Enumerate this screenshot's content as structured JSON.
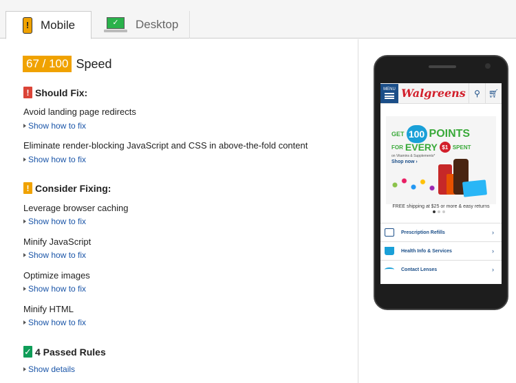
{
  "tabs": {
    "mobile_label": "Mobile",
    "desktop_label": "Desktop"
  },
  "score": {
    "value": "67 / 100",
    "label": "Speed",
    "color": "#f0a200"
  },
  "sections": {
    "should_fix": {
      "title": "Should Fix:",
      "badge": "!",
      "color": "#db4437",
      "rules": [
        {
          "title": "Avoid landing page redirects",
          "link": "Show how to fix"
        },
        {
          "title": "Eliminate render-blocking JavaScript and CSS in above-the-fold content",
          "link": "Show how to fix"
        }
      ]
    },
    "consider_fixing": {
      "title": "Consider Fixing:",
      "badge": "!",
      "color": "#f0a200",
      "rules": [
        {
          "title": "Leverage browser caching",
          "link": "Show how to fix"
        },
        {
          "title": "Minify JavaScript",
          "link": "Show how to fix"
        },
        {
          "title": "Optimize images",
          "link": "Show how to fix"
        },
        {
          "title": "Minify HTML",
          "link": "Show how to fix"
        }
      ]
    },
    "passed": {
      "title": "4 Passed Rules",
      "badge": "✓",
      "color": "#0f9d58",
      "link": "Show details"
    }
  },
  "preview": {
    "menu_label": "MENU",
    "logo": "Walgreens",
    "promo": {
      "get": "GET",
      "hundred": "100",
      "points": "POINTS",
      "for": "FOR",
      "every": "EVERY",
      "dollar": "$1",
      "spent": "SPENT",
      "sub": "on Vitamins & Supplements*",
      "shop": "Shop now ›"
    },
    "free_shipping": "FREE shipping at $25 or more & easy returns",
    "list": [
      {
        "label": "Prescription Refills",
        "icon": "prescription-icon"
      },
      {
        "label": "Health Info & Services",
        "icon": "health-icon"
      },
      {
        "label": "Contact Lenses",
        "icon": "contact-lens-icon"
      }
    ]
  }
}
